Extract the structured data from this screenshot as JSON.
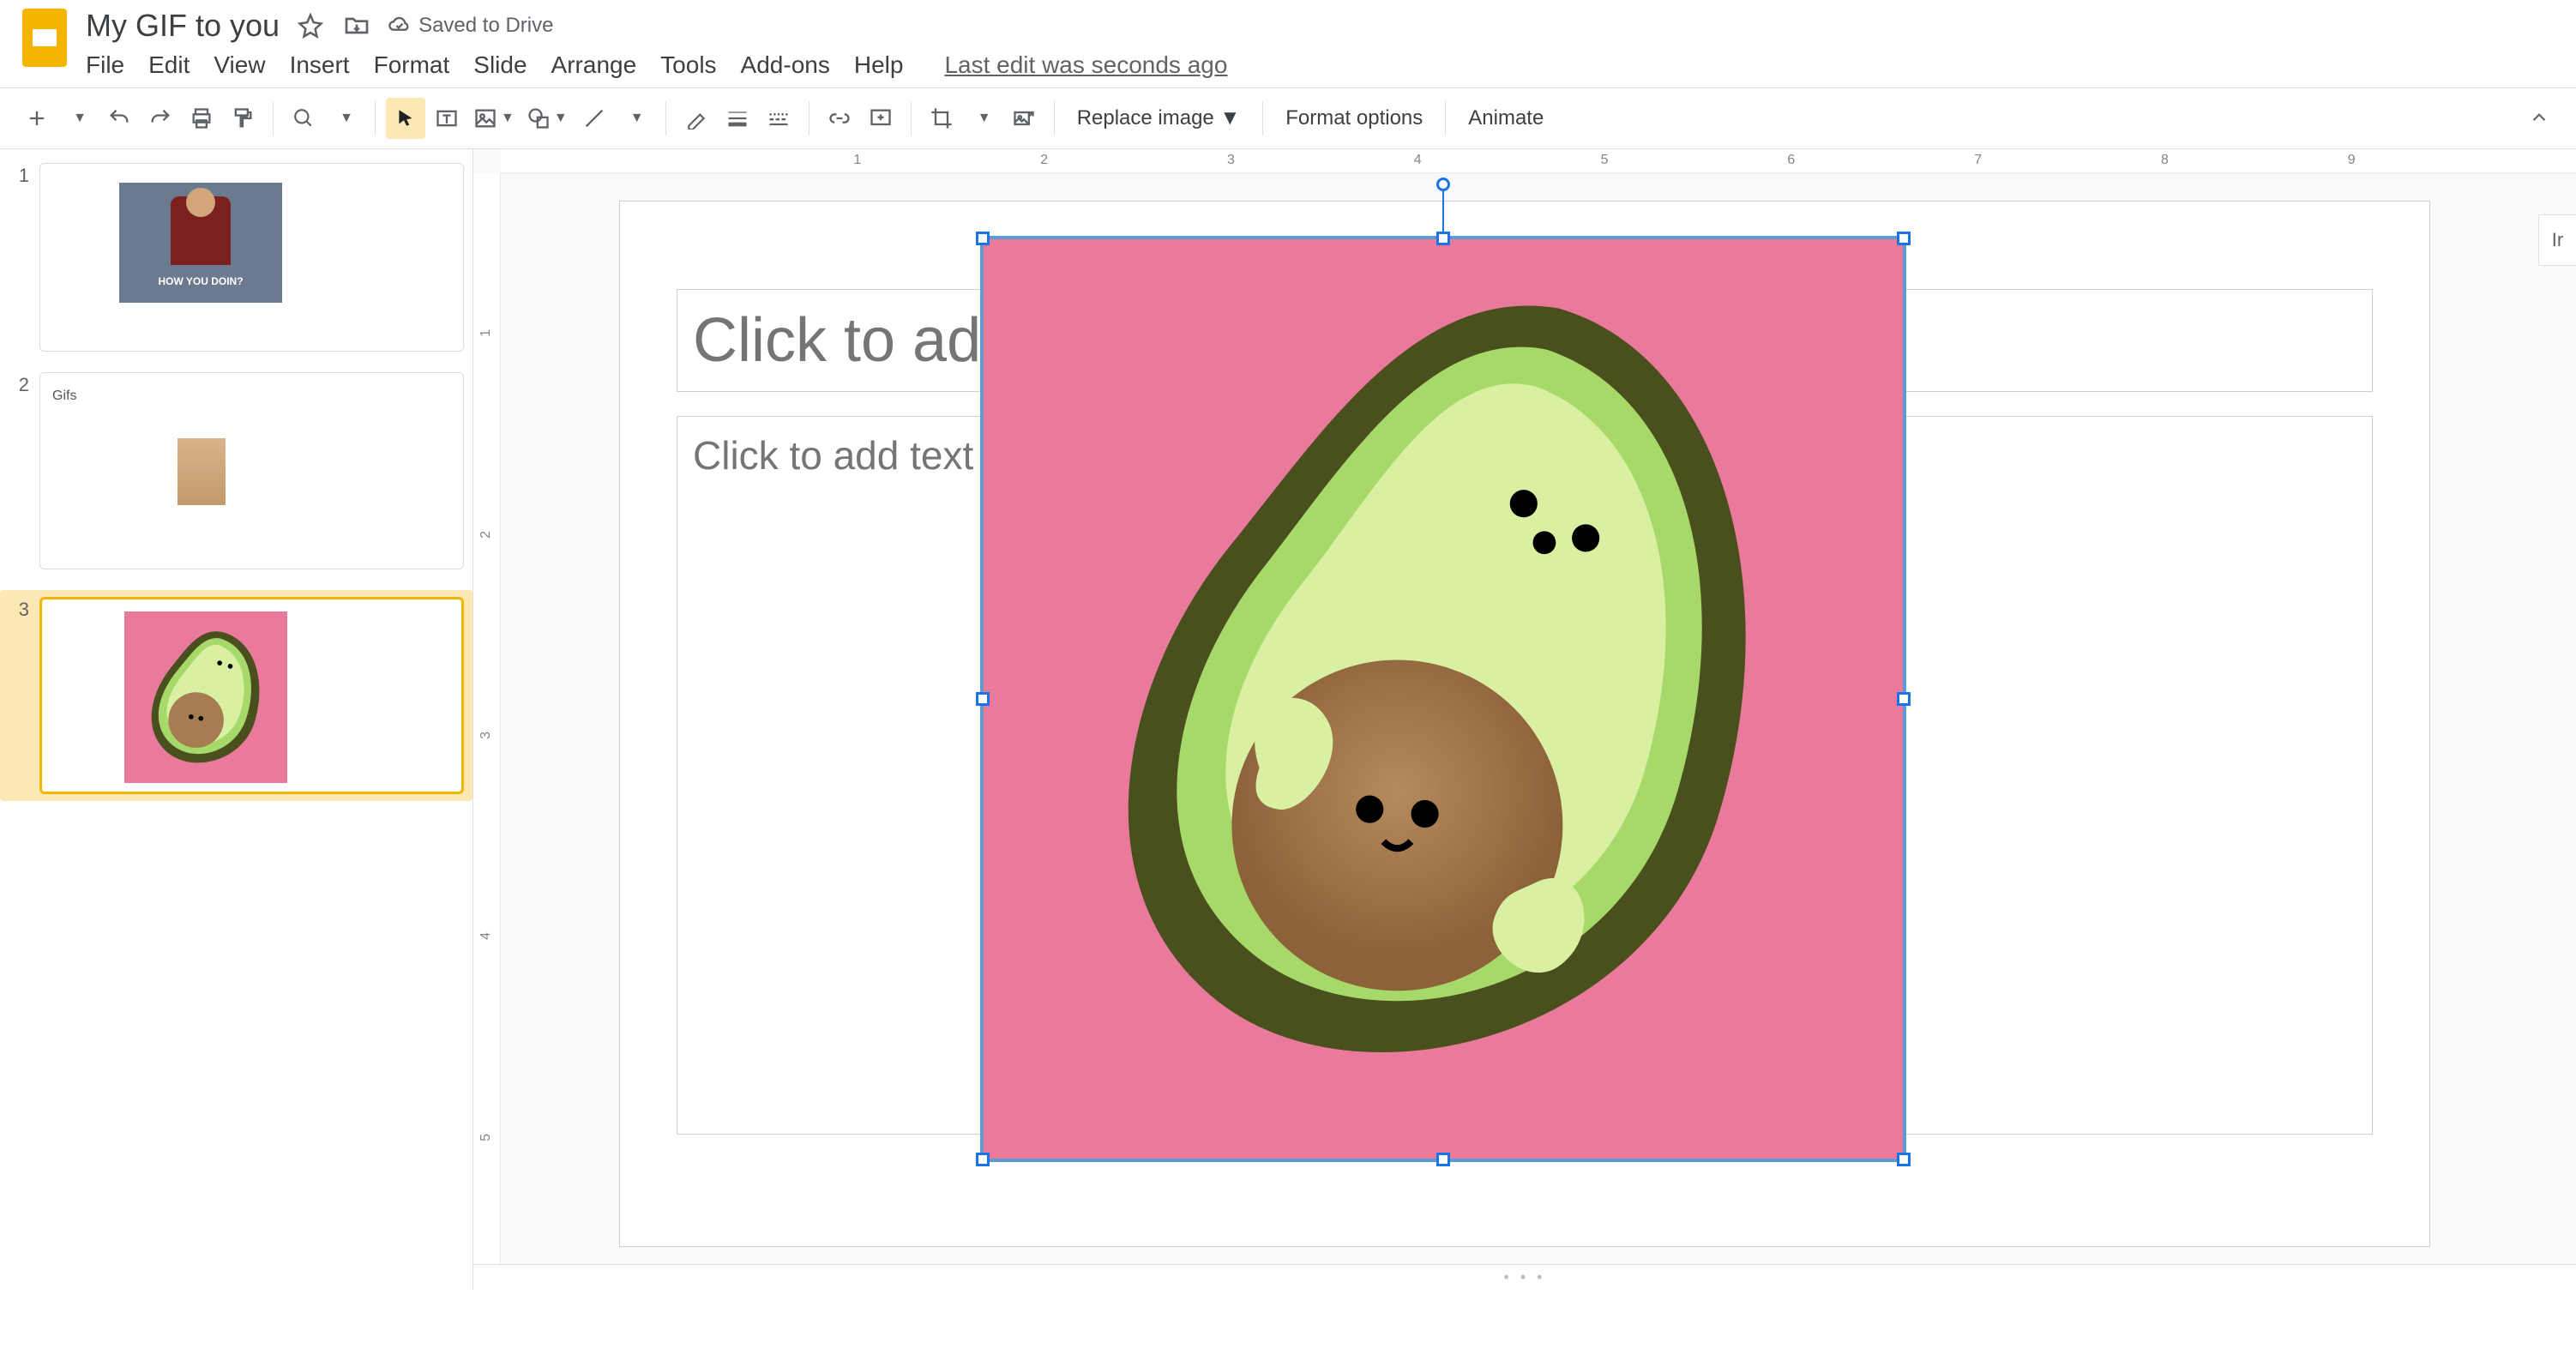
{
  "header": {
    "doc_title": "My GIF to you",
    "saved_text": "Saved to Drive"
  },
  "menubar": {
    "items": [
      "File",
      "Edit",
      "View",
      "Insert",
      "Format",
      "Slide",
      "Arrange",
      "Tools",
      "Add-ons",
      "Help"
    ],
    "last_edit": "Last edit was seconds ago"
  },
  "toolbar": {
    "replace_image": "Replace image",
    "format_options": "Format options",
    "animate": "Animate"
  },
  "ruler_h": [
    "1",
    "2",
    "3",
    "4",
    "5",
    "6",
    "7",
    "8",
    "9"
  ],
  "ruler_v": [
    "1",
    "2",
    "3",
    "4",
    "5"
  ],
  "slide": {
    "title_placeholder": "Click to add title",
    "body_placeholder": "Click to add text",
    "title_visible_fragment": "Click to add"
  },
  "thumbnails": [
    {
      "num": "1",
      "caption": "HOW YOU DOIN?"
    },
    {
      "num": "2",
      "label": "Gifs"
    },
    {
      "num": "3"
    }
  ],
  "right_panel_hint": "Ir",
  "selected_slide_index": 3,
  "image": {
    "description": "Cartoon avocado hugging its pit on pink background",
    "bg_color": "#e97a9b",
    "skin_color": "#4a4f1e",
    "flesh_outer": "#a6d96a",
    "flesh_inner": "#d9f0a3",
    "pit_color": "#a67c52",
    "pit_shadow": "#8c6239"
  }
}
